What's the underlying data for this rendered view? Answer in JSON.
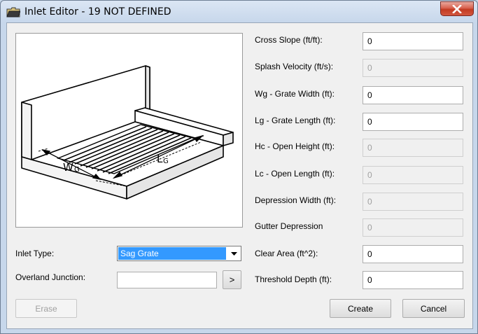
{
  "window": {
    "title": "Inlet Editor - 19 NOT DEFINED"
  },
  "diagram": {
    "width_label": "W",
    "width_sub": "G",
    "length_label": "L",
    "length_sub": "G"
  },
  "form": {
    "inlet_type_label": "Inlet Type:",
    "inlet_type_value": "Sag Grate",
    "overland_junction_label": "Overland Junction:",
    "overland_junction_value": "",
    "browse_label": ">",
    "fields": [
      {
        "label": "Cross Slope (ft/ft):",
        "value": "0",
        "enabled": true
      },
      {
        "label": "Splash Velocity (ft/s):",
        "value": "0",
        "enabled": false
      },
      {
        "label": "Wg - Grate Width (ft):",
        "value": "0",
        "enabled": true
      },
      {
        "label": "Lg - Grate Length (ft):",
        "value": "0",
        "enabled": true
      },
      {
        "label": "Hc - Open Height (ft):",
        "value": "0",
        "enabled": false
      },
      {
        "label": "Lc - Open Length (ft):",
        "value": "0",
        "enabled": false
      },
      {
        "label": "Depression Width (ft):",
        "value": "0",
        "enabled": false
      },
      {
        "label": "Gutter Depression",
        "value": "0",
        "enabled": false
      },
      {
        "label": "Clear Area (ft^2):",
        "value": "0",
        "enabled": true
      },
      {
        "label": "Threshold Depth (ft):",
        "value": "0",
        "enabled": true
      }
    ]
  },
  "buttons": {
    "erase": "Erase",
    "create": "Create",
    "cancel": "Cancel"
  }
}
